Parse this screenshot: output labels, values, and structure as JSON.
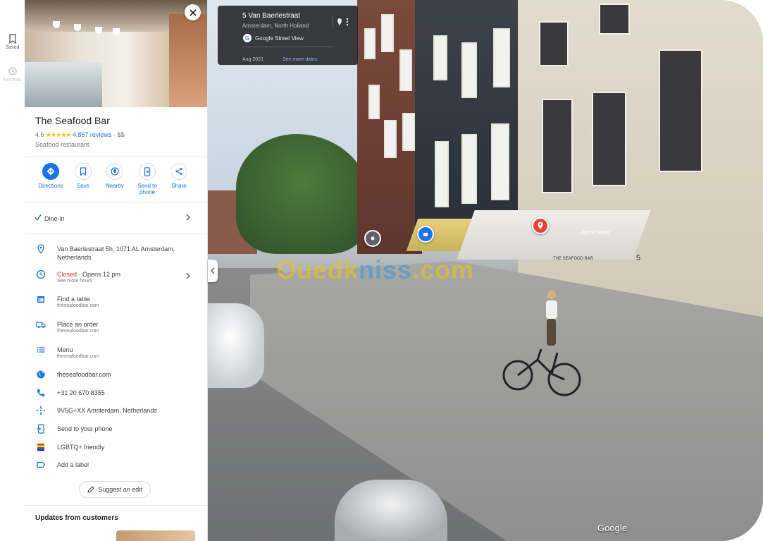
{
  "rail": {
    "saved_label": "Saved",
    "recents_label": "Recents"
  },
  "place": {
    "name": "The Seafood Bar",
    "rating": "4.6",
    "stars": "★★★★★",
    "reviews": "4,867 reviews",
    "price": "$$",
    "category": "Seafood restaurant"
  },
  "actions": [
    {
      "label": "Directions",
      "icon": "directions-icon"
    },
    {
      "label": "Save",
      "icon": "bookmark-icon"
    },
    {
      "label": "Nearby",
      "icon": "nearby-icon"
    },
    {
      "label": "Send to",
      "label2": "phone",
      "icon": "send-to-phone-icon"
    },
    {
      "label": "Share",
      "icon": "share-icon"
    }
  ],
  "dine_in": "Dine-in",
  "info": {
    "address": "Van Baerlestraat 5h, 1071 AL Amsterdam, Netherlands",
    "hours_status": "Closed",
    "hours_opens": " · Opens 12 pm",
    "hours_more": "See more hours",
    "table_title": "Find a table",
    "table_site": "theseafoodbar.com",
    "order_title": "Place an order",
    "order_site": "theseafoodbar.com",
    "menu_title": "Menu",
    "menu_site": "theseafoodbar.com",
    "website": "theseafoodbar.com",
    "phone": "+31 20 670 8355",
    "plus_code": "9V5G+XX Amsterdam, Netherlands",
    "send_phone": "Send to your phone",
    "lgbtq": "LGBTQ+ friendly",
    "add_label": "Add a label"
  },
  "suggest_edit": "Suggest an edit",
  "updates_title": "Updates from customers",
  "streetview": {
    "address": "5 Van Baerlestraat",
    "city": "Amsterdam, North Holland",
    "source": "Google Street View",
    "date": "Aug 2021",
    "more_dates": "See more dates",
    "watermark_a": "Ouedk",
    "watermark_b": "niss",
    "watermark_c": ".com",
    "google": "Google",
    "store_sign": "Apotheker",
    "seafood_sign": "THE SEAFOOD BAR",
    "house_number": "5"
  },
  "colors": {
    "accent": "#1a73e8",
    "closed": "#d93025",
    "stars": "#fbbc04"
  }
}
